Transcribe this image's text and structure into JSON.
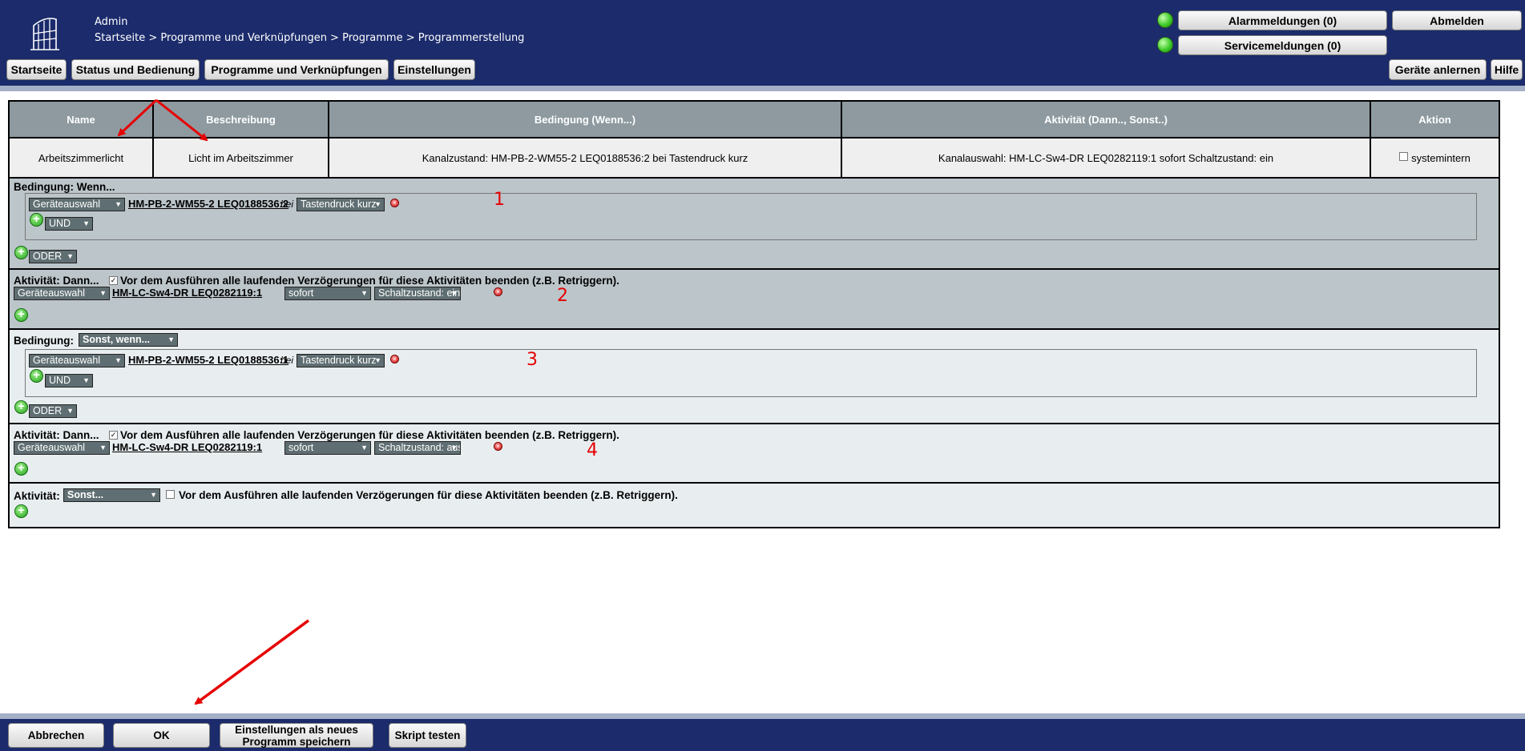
{
  "header": {
    "user": "Admin",
    "breadcrumb": "Startseite > Programme und Verknüpfungen > Programme > Programmerstellung",
    "nav": [
      "Startseite",
      "Status und Bedienung",
      "Programme und Verknüpfungen",
      "Einstellungen"
    ],
    "alarm_label": "Alarmmeldungen (0)",
    "service_label": "Servicemeldungen (0)",
    "logout_label": "Abmelden",
    "learn_label": "Geräte anlernen",
    "help_label": "Hilfe"
  },
  "table": {
    "columns": [
      "Name",
      "Beschreibung",
      "Bedingung (Wenn...)",
      "Aktivität (Dann.., Sonst..)",
      "Aktion"
    ],
    "row": {
      "name": "Arbeitszimmerlicht",
      "description": "Licht im Arbeitszimmer",
      "condition": "Kanalzustand: HM-PB-2-WM55-2 LEQ0188536:2 bei Tastendruck kurz",
      "activity": "Kanalauswahl: HM-LC-Sw4-DR LEQ0282119:1 sofort Schaltzustand: ein",
      "action_checkbox": "systemintern"
    }
  },
  "sections": {
    "cond1": {
      "title": "Bedingung: Wenn...",
      "device_select": "Geräteauswahl",
      "device": "HM-PB-2-WM55-2 LEQ0188536:2",
      "bei": "bei",
      "trigger": "Tastendruck kurz",
      "and_label": "UND",
      "or_label": "ODER",
      "marker": "1"
    },
    "act1": {
      "title": "Aktivität: Dann...",
      "retrigger_label": "Vor dem Ausführen alle laufenden Verzögerungen für diese Aktivitäten beenden (z.B. Retriggern).",
      "device_select": "Geräteauswahl",
      "device": "HM-LC-Sw4-DR LEQ0282119:1",
      "timing": "sofort",
      "state": "Schaltzustand: ein",
      "marker": "2"
    },
    "cond2": {
      "title": "Bedingung:",
      "mode": "Sonst, wenn...",
      "device_select": "Geräteauswahl",
      "device": "HM-PB-2-WM55-2 LEQ0188536:1",
      "bei": "bei",
      "trigger": "Tastendruck kurz",
      "and_label": "UND",
      "or_label": "ODER",
      "marker": "3"
    },
    "act2": {
      "title": "Aktivität: Dann...",
      "retrigger_label": "Vor dem Ausführen alle laufenden Verzögerungen für diese Aktivitäten beenden (z.B. Retriggern).",
      "device_select": "Geräteauswahl",
      "device": "HM-LC-Sw4-DR LEQ0282119:1",
      "timing": "sofort",
      "state": "Schaltzustand: aus",
      "marker": "4"
    },
    "act3": {
      "title": "Aktivität:",
      "mode": "Sonst...",
      "retrigger_label": "Vor dem Ausführen alle laufenden Verzögerungen für diese Aktivitäten beenden (z.B. Retriggern)."
    }
  },
  "footer": {
    "cancel": "Abbrechen",
    "ok": "OK",
    "save_line1": "Einstellungen als neues",
    "save_line2": "Programm speichern",
    "test": "Skript testen"
  },
  "colors": {
    "header_bg": "#1b2b6b",
    "column_header": "#8e9aa0",
    "section_dark": "#bcc5ca",
    "section_light": "#e8eef0",
    "annotation_red": "#e60000",
    "status_led": "#3fcb2a"
  }
}
